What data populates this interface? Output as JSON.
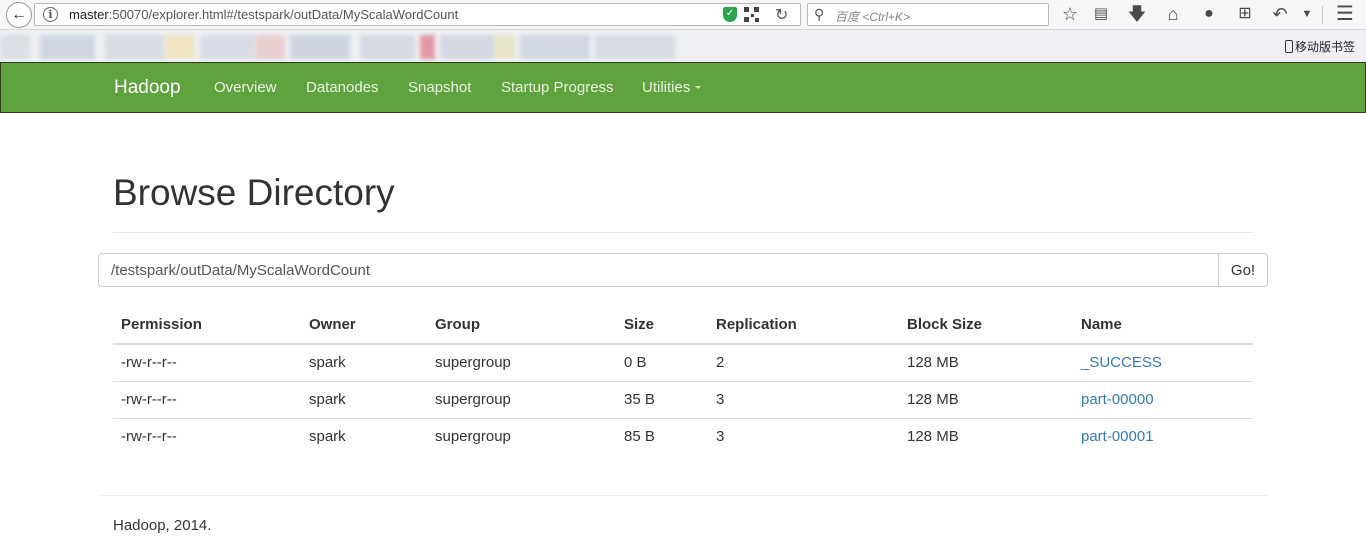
{
  "browser": {
    "url_host": "master",
    "url_rest": ":50070/explorer.html#/testspark/outData/MyScalaWordCount",
    "search_placeholder": "百度 <Ctrl+K>",
    "mobile_bookmarks": "移动版书签",
    "icons": [
      "back-arrow-icon",
      "info-icon",
      "shield-icon",
      "qr-code-icon",
      "reload-icon",
      "search-icon",
      "star-icon",
      "reading-list-icon",
      "download-icon",
      "home-icon",
      "chat-icon",
      "crop-icon",
      "undo-icon",
      "dropdown-icon",
      "menu-icon"
    ]
  },
  "navbar": {
    "brand": "Hadoop",
    "items": [
      {
        "label": "Overview"
      },
      {
        "label": "Datanodes"
      },
      {
        "label": "Snapshot"
      },
      {
        "label": "Startup Progress"
      },
      {
        "label": "Utilities"
      }
    ],
    "background": "#5fa33e"
  },
  "page": {
    "title": "Browse Directory",
    "path_value": "/testspark/outData/MyScalaWordCount",
    "go_label": "Go!"
  },
  "table": {
    "columns": [
      "Permission",
      "Owner",
      "Group",
      "Size",
      "Replication",
      "Block Size",
      "Name"
    ],
    "rows": [
      {
        "permission": "-rw-r--r--",
        "owner": "spark",
        "group": "supergroup",
        "size": "0 B",
        "replication": "2",
        "block_size": "128 MB",
        "name": "_SUCCESS"
      },
      {
        "permission": "-rw-r--r--",
        "owner": "spark",
        "group": "supergroup",
        "size": "35 B",
        "replication": "3",
        "block_size": "128 MB",
        "name": "part-00000"
      },
      {
        "permission": "-rw-r--r--",
        "owner": "spark",
        "group": "supergroup",
        "size": "85 B",
        "replication": "3",
        "block_size": "128 MB",
        "name": "part-00001"
      }
    ],
    "link_color": "#337ab7"
  },
  "footer": {
    "text": "Hadoop, 2014."
  }
}
